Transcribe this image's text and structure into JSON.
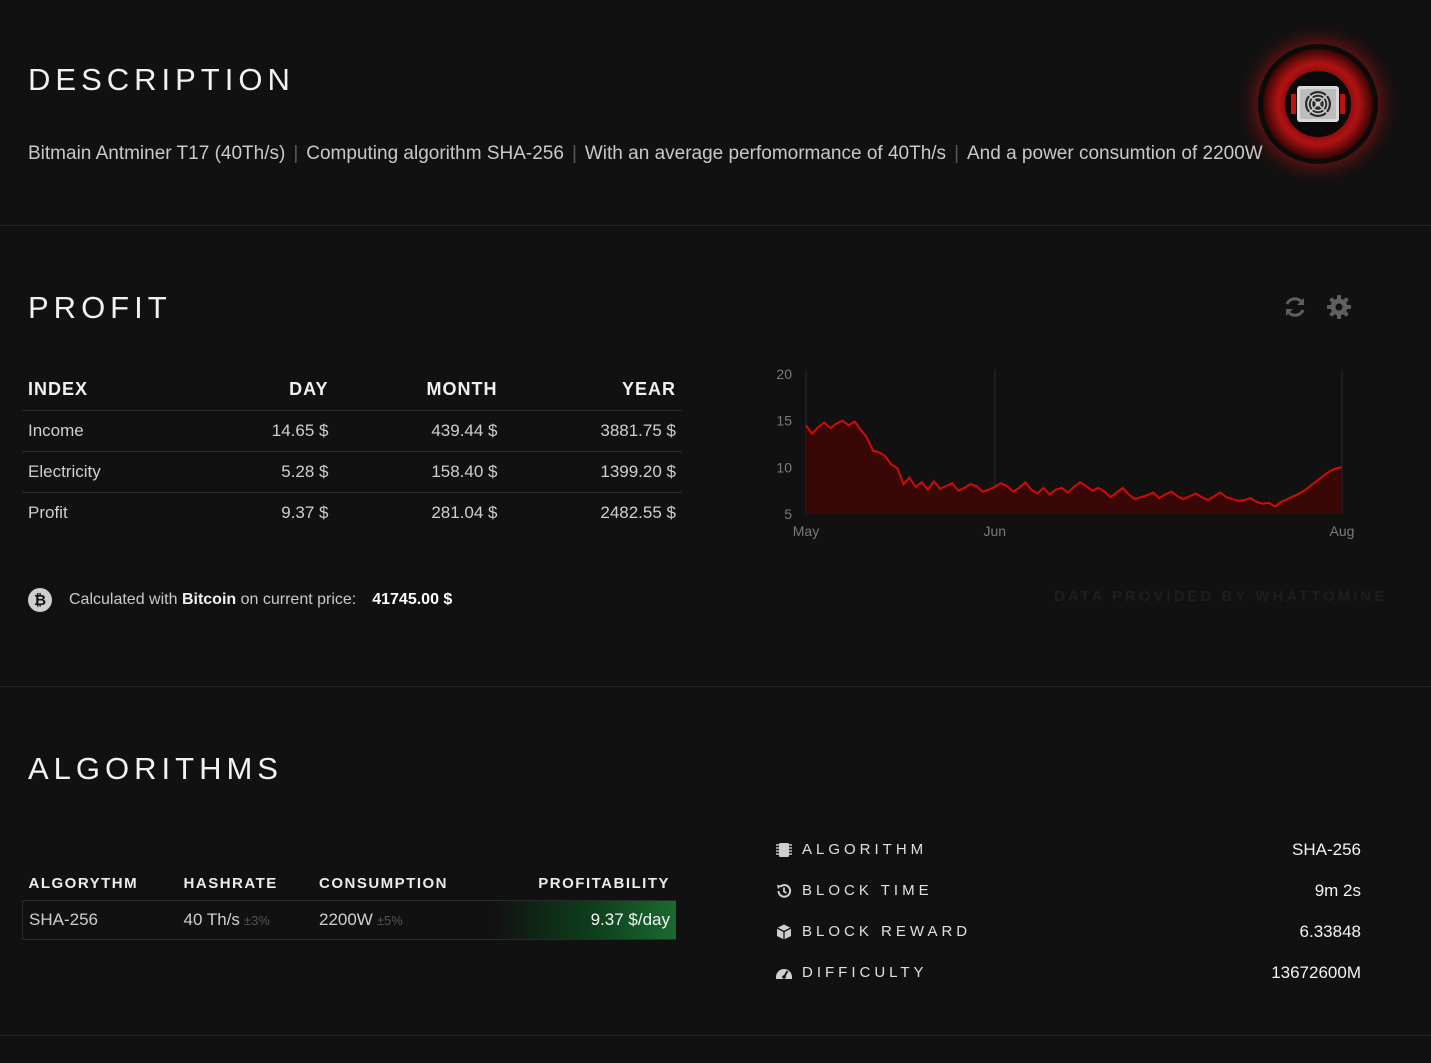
{
  "description": {
    "title": "DESCRIPTION",
    "parts": [
      "Bitmain Antminer T17 (40Th/s)",
      "Computing algorithm SHA-256",
      "With an average perfomormance of 40Th/s",
      "And a power consumtion of 2200W"
    ],
    "separator": "|"
  },
  "profit": {
    "title": "PROFIT",
    "table": {
      "headers": [
        "INDEX",
        "DAY",
        "MONTH",
        "YEAR"
      ],
      "rows": [
        [
          "Income",
          "14.65 $",
          "439.44 $",
          "3881.75 $"
        ],
        [
          "Electricity",
          "5.28 $",
          "158.40 $",
          "1399.20 $"
        ],
        [
          "Profit",
          "9.37 $",
          "281.04 $",
          "2482.55 $"
        ]
      ]
    },
    "calc_prefix": "Calculated with",
    "calc_coin": "Bitcoin",
    "calc_suffix": "on current price:",
    "calc_price": "41745.00 $",
    "coin_symbol": "₿",
    "provided": "DATA PROVIDED BY WHATTOMINE"
  },
  "chart_data": {
    "type": "area",
    "x_tick_labels": [
      "May",
      "Jun",
      "Aug"
    ],
    "y_ticks": [
      5,
      10,
      15,
      20
    ],
    "ylim": [
      5,
      20
    ],
    "line_color": "#d10a0a",
    "fill_color": "#3a0707",
    "values": [
      14.5,
      13.6,
      14.3,
      14.8,
      14.2,
      14.7,
      15.0,
      14.5,
      14.9,
      14.0,
      13.2,
      11.8,
      11.6,
      11.2,
      10.3,
      9.9,
      8.2,
      8.9,
      7.9,
      8.4,
      7.6,
      8.5,
      7.7,
      8.0,
      8.3,
      7.5,
      7.8,
      8.2,
      8.0,
      7.4,
      7.6,
      7.9,
      8.3,
      8.0,
      7.4,
      7.8,
      8.4,
      7.6,
      7.2,
      7.8,
      7.1,
      7.6,
      7.8,
      7.3,
      7.9,
      8.4,
      8.0,
      7.5,
      7.8,
      7.4,
      6.8,
      7.3,
      7.8,
      7.1,
      6.6,
      6.8,
      7.0,
      7.3,
      6.7,
      7.1,
      7.4,
      6.9,
      6.6,
      6.9,
      7.2,
      6.8,
      6.5,
      6.9,
      7.3,
      6.8,
      6.6,
      6.4,
      6.5,
      6.7,
      6.3,
      6.1,
      6.2,
      5.8,
      6.3,
      6.6,
      6.9,
      7.2,
      7.6,
      8.1,
      8.6,
      9.1,
      9.6,
      9.9,
      10.0
    ],
    "x_month_markers": [
      {
        "label": "May",
        "index": 0
      },
      {
        "label": "Jun",
        "index": 31
      },
      {
        "label": "Aug",
        "index": 88
      }
    ]
  },
  "algorithms": {
    "title": "ALGORITHMS",
    "table": {
      "headers": [
        "ALGORYTHM",
        "HASHRATE",
        "CONSUMPTION",
        "PROFITABILITY"
      ],
      "row": {
        "algo": "SHA-256",
        "hashrate": "40 Th/s",
        "hashrate_tol": "±3%",
        "consumption": "2200W",
        "consumption_tol": "±5%",
        "profitability": "9.37 $/day"
      }
    },
    "info": [
      {
        "icon": "chip-icon",
        "label": "ALGORITHM",
        "value": "SHA-256"
      },
      {
        "icon": "history-icon",
        "label": "BLOCK TIME",
        "value": "9m 2s"
      },
      {
        "icon": "cube-icon",
        "label": "BLOCK REWARD",
        "value": "6.33848"
      },
      {
        "icon": "gauge-icon",
        "label": "DIFFICULTY",
        "value": "13672600M"
      }
    ]
  }
}
